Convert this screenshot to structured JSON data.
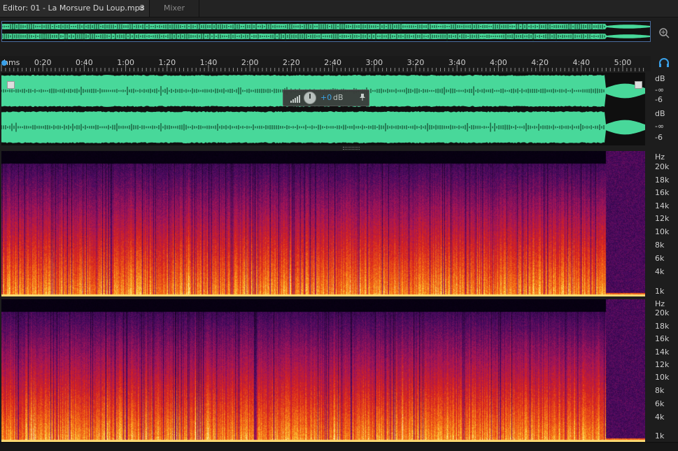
{
  "tabs": {
    "editor_label": "Editor: 01 - La Morsure Du Loup.mp3",
    "menu_glyph": "≡",
    "mixer_label": "Mixer"
  },
  "overview": {
    "accent_color": "#4a6d9e"
  },
  "icons": {
    "zoom": "zoom-icon",
    "headphones": "headphones-icon",
    "pin": "pin-icon"
  },
  "ruler": {
    "unit_label": "hms",
    "times": [
      "0:20",
      "0:40",
      "1:00",
      "1:20",
      "1:40",
      "2:00",
      "2:20",
      "2:40",
      "3:00",
      "3:20",
      "3:40",
      "4:00",
      "4:20",
      "4:40",
      "5:00"
    ]
  },
  "waveform": {
    "color": "#48d89a"
  },
  "db_scale": {
    "unit": "dB",
    "inf": "-∞",
    "minus6": "-6"
  },
  "hud": {
    "value": "+0",
    "unit": "dB"
  },
  "spectral_scale": {
    "unit": "Hz",
    "top_labels": [
      "20k",
      "18k",
      "16k",
      "14k",
      "12k",
      "10k",
      "8k",
      "6k",
      "4k",
      "1k"
    ],
    "bottom_labels": [
      "20k",
      "18k",
      "16k",
      "14k",
      "12k",
      "10k",
      "8k",
      "6k",
      "4k",
      "1k"
    ]
  }
}
